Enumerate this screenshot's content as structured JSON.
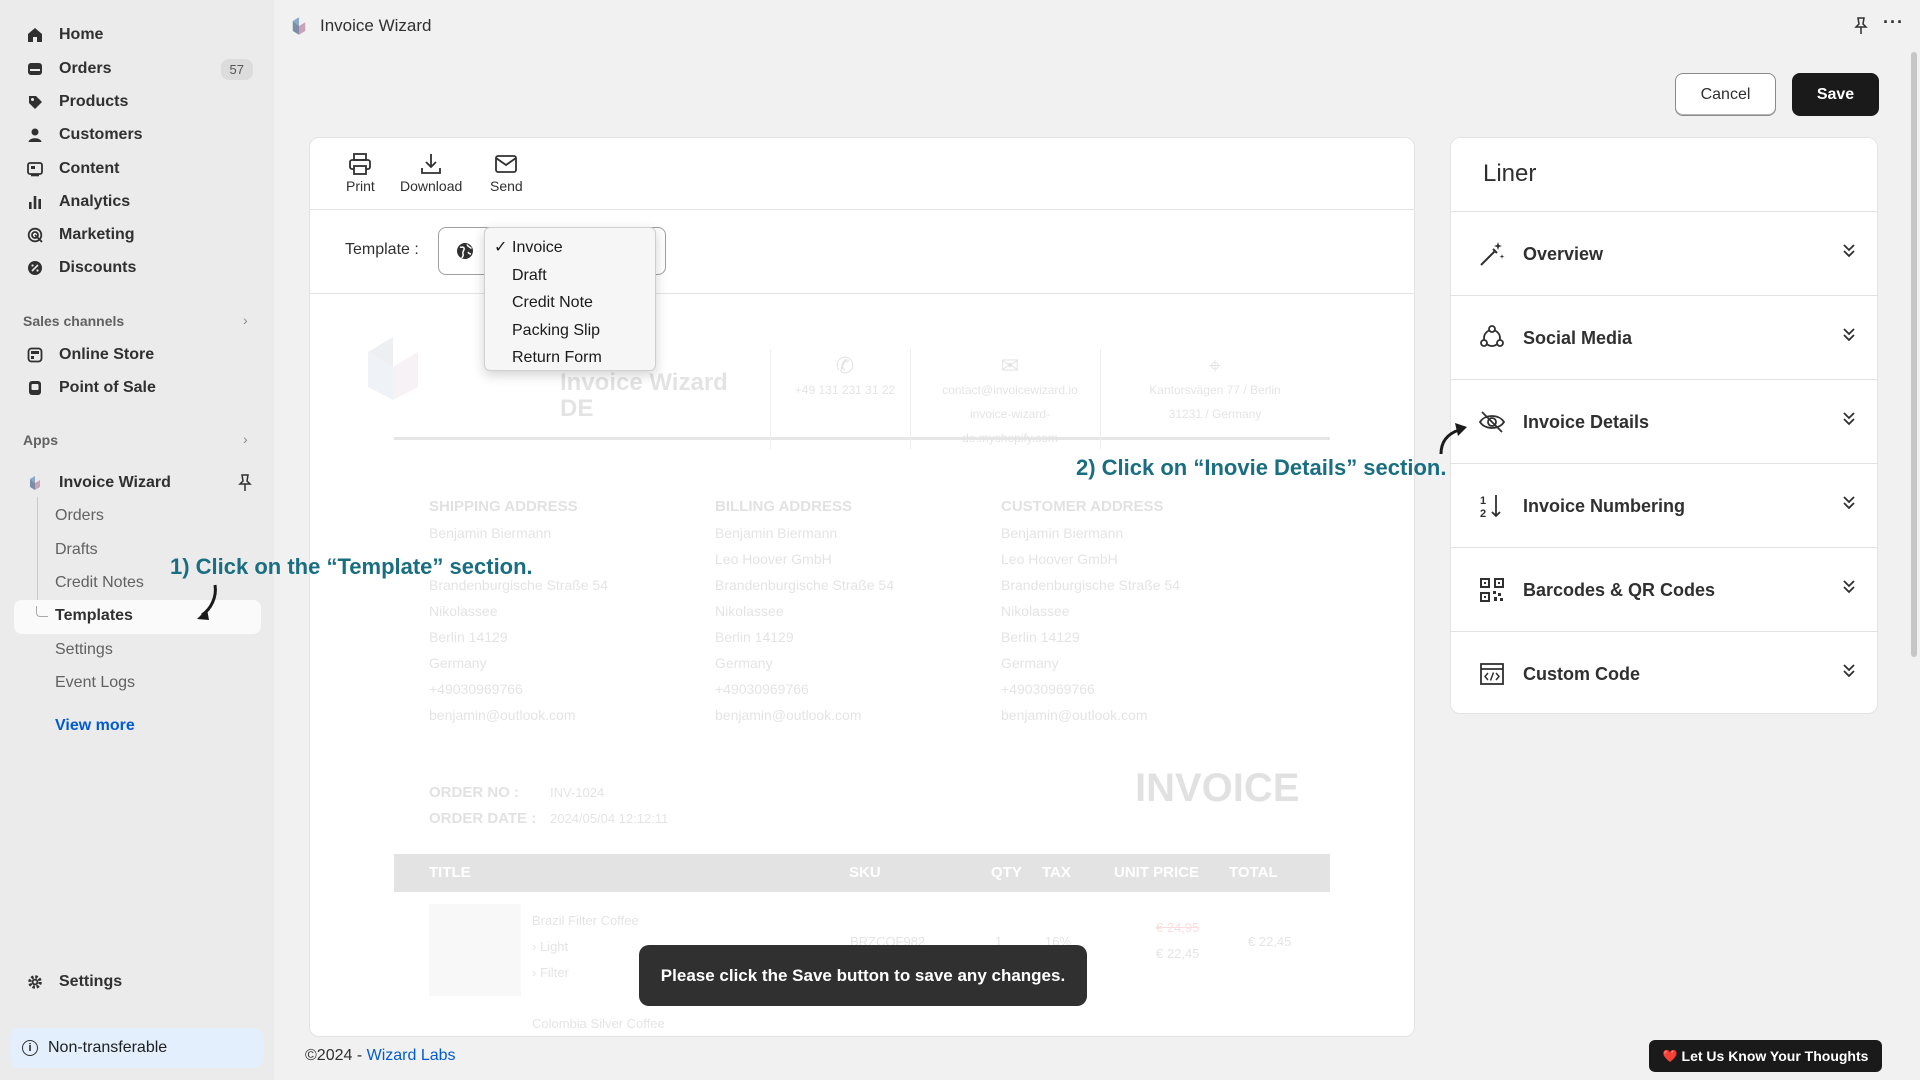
{
  "sidebar": {
    "items": [
      {
        "label": "Home",
        "icon": "home-icon"
      },
      {
        "label": "Orders",
        "icon": "orders-icon",
        "badge": "57"
      },
      {
        "label": "Products",
        "icon": "tag-icon"
      },
      {
        "label": "Customers",
        "icon": "person-icon"
      },
      {
        "label": "Content",
        "icon": "content-icon"
      },
      {
        "label": "Analytics",
        "icon": "bar-chart-icon"
      },
      {
        "label": "Marketing",
        "icon": "target-icon"
      },
      {
        "label": "Discounts",
        "icon": "discount-icon"
      }
    ],
    "sales_channels": {
      "title": "Sales channels",
      "items": [
        {
          "label": "Online Store",
          "icon": "store-icon"
        },
        {
          "label": "Point of Sale",
          "icon": "pos-icon"
        }
      ]
    },
    "apps": {
      "title": "Apps",
      "app_name": "Invoice Wizard",
      "sub_items": [
        "Orders",
        "Drafts",
        "Credit Notes",
        "Templates",
        "Settings",
        "Event Logs"
      ],
      "active_sub": "Templates",
      "view_more": "View more"
    },
    "settings": "Settings",
    "non_transferable": "Non-transferable"
  },
  "topbar": {
    "title": "Invoice Wizard"
  },
  "actions": {
    "cancel": "Cancel",
    "save": "Save"
  },
  "toolbar": {
    "print": "Print",
    "download": "Download",
    "send": "Send"
  },
  "template": {
    "label": "Template :",
    "options": [
      "Invoice",
      "Draft",
      "Credit Note",
      "Packing Slip",
      "Return Form"
    ],
    "selected": "Invoice",
    "check": "✓"
  },
  "invoice_preview": {
    "brand_line1": "Invoice Wizard",
    "brand_line2": "DE",
    "phone": "+49 131 231 31 22",
    "email_line1": "contact@invoicewizard.io",
    "email_line2": "invoice-wizard-",
    "email_line3": "de.myshopify.com",
    "address_line1": "Kantorsvägen 77 / Berlin",
    "address_line2": "31231 / Germany",
    "shipping": {
      "heading": "SHIPPING ADDRESS",
      "lines": [
        "Benjamin Biermann",
        "",
        "Brandenburgische Straße 54",
        "Nikolassee",
        "Berlin 14129",
        "Germany",
        "+49030969766",
        "benjamin@outlook.com"
      ]
    },
    "billing": {
      "heading": "BILLING ADDRESS",
      "lines": [
        "Benjamin Biermann",
        "Leo Hoover GmbH",
        "Brandenburgische Straße 54",
        "Nikolassee",
        "Berlin 14129",
        "Germany",
        "+49030969766",
        "benjamin@outlook.com"
      ]
    },
    "customer": {
      "heading": "CUSTOMER ADDRESS",
      "lines": [
        "Benjamin Biermann",
        "Leo Hoover GmbH",
        "Brandenburgische Straße 54",
        "Nikolassee",
        "Berlin 14129",
        "Germany",
        "+49030969766",
        "benjamin@outlook.com"
      ]
    },
    "order_no_label": "ORDER NO :",
    "order_no": "INV-1024",
    "order_date_label": "ORDER DATE :",
    "order_date": "2024/05/04 12:12:11",
    "doc_title": "INVOICE",
    "columns": [
      "TITLE",
      "SKU",
      "QTY",
      "TAX",
      "UNIT PRICE",
      "TOTAL"
    ],
    "product": {
      "name": "Brazil Filter Coffee",
      "opt1": "Light",
      "opt2": "Filter",
      "sku": "BRZCOF982",
      "qty": "1",
      "tax": "16%",
      "old_price": "€ 24,95",
      "price": "€ 22,45",
      "total": "€ 22,45"
    },
    "next_product": "Colombia Silver Coffee"
  },
  "toast": "Please click the Save button to save any changes.",
  "panel": {
    "title": "Liner",
    "sections": [
      {
        "label": "Overview",
        "icon": "magic-wand-icon"
      },
      {
        "label": "Social Media",
        "icon": "share-network-icon"
      },
      {
        "label": "Invoice Details",
        "icon": "eye-off-icon"
      },
      {
        "label": "Invoice Numbering",
        "icon": "sort-numeric-icon"
      },
      {
        "label": "Barcodes & QR Codes",
        "icon": "qr-code-icon"
      },
      {
        "label": "Custom Code",
        "icon": "code-window-icon"
      }
    ]
  },
  "annotations": {
    "step1": "1) Click on the “Template” section.",
    "step2": "2) Click on “Inovie Details” section."
  },
  "footer": {
    "copyright": "©2024 - ",
    "link": "Wizard Labs",
    "feedback": "Let Us Know Your Thoughts",
    "feedback_icon": "❤️"
  },
  "colors": {
    "accent": "#005bd3",
    "annotation": "#1a6e82",
    "primary_button": "#1a1a1a",
    "sidebar_bg": "#ebebeb"
  }
}
